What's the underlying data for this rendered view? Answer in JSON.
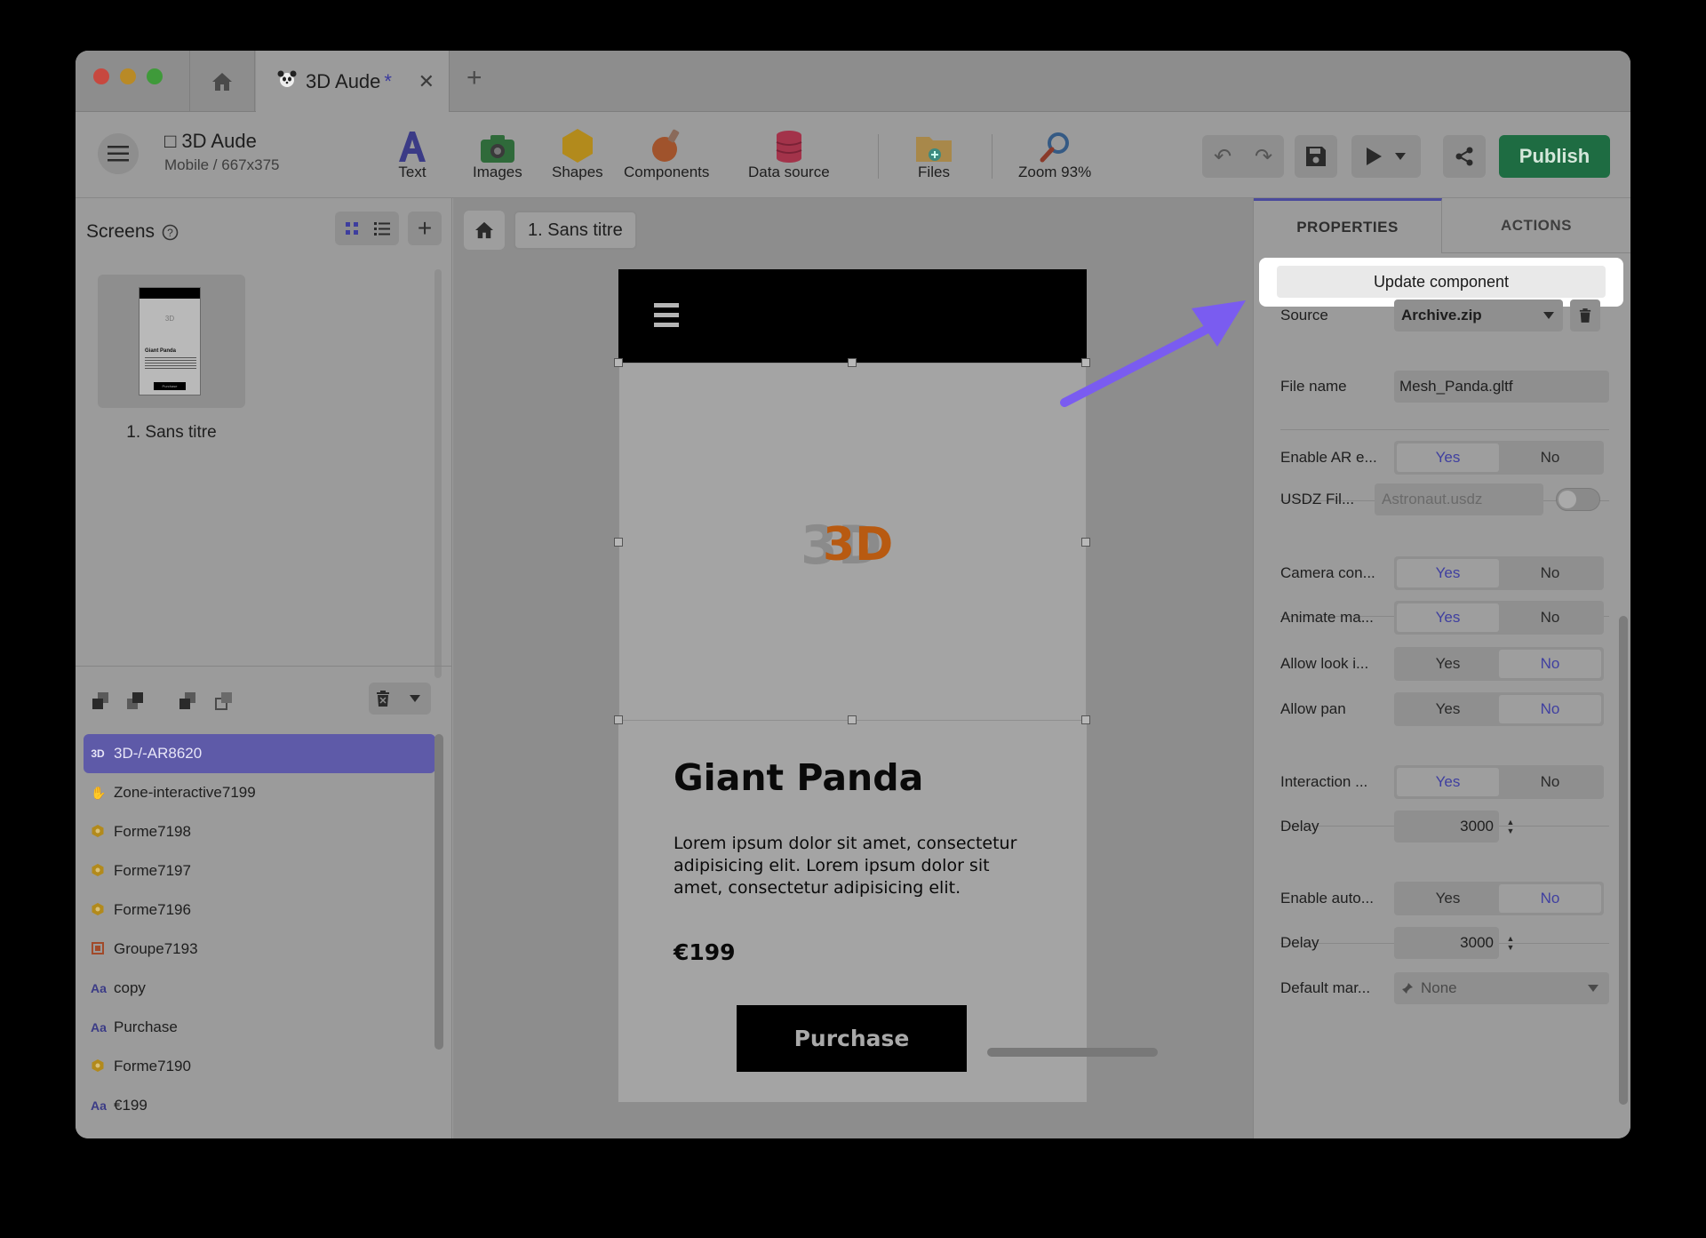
{
  "tab": {
    "title": "3D Aude",
    "modified": "*"
  },
  "project": {
    "title": "□ 3D Aude",
    "subtitle": "Mobile / 667x375"
  },
  "toolbar": {
    "text": "Text",
    "images": "Images",
    "shapes": "Shapes",
    "components": "Components",
    "data_source": "Data source",
    "files": "Files",
    "zoom": "Zoom 93%",
    "publish": "Publish"
  },
  "screens": {
    "title": "Screens",
    "items": [
      {
        "label": "1. Sans titre"
      }
    ]
  },
  "thumb": {
    "title": "Giant Panda",
    "button": "Purchase",
    "logo": "3D"
  },
  "layers": [
    {
      "icon": "3D",
      "label": "3D-/-AR8620"
    },
    {
      "icon": "hand",
      "label": "Zone-interactive7199"
    },
    {
      "icon": "hex",
      "label": "Forme7198"
    },
    {
      "icon": "hex",
      "label": "Forme7197"
    },
    {
      "icon": "hex",
      "label": "Forme7196"
    },
    {
      "icon": "group",
      "label": "Groupe7193"
    },
    {
      "icon": "Aa",
      "label": "copy"
    },
    {
      "icon": "Aa",
      "label": "Purchase"
    },
    {
      "icon": "hex",
      "label": "Forme7190"
    },
    {
      "icon": "Aa",
      "label": "€199"
    }
  ],
  "canvas": {
    "breadcrumb": "1. Sans titre",
    "logo": "3D",
    "product_title": "Giant Panda",
    "description": "Lorem ipsum dolor sit amet, consectetur adipisicing elit. Lorem ipsum dolor sit amet, consectetur adipisicing elit.",
    "price": "€199",
    "button": "Purchase"
  },
  "panel": {
    "tab_properties": "PROPERTIES",
    "tab_actions": "ACTIONS",
    "update_button": "Update component",
    "source_label": "Source",
    "source_value": "Archive.zip",
    "filename_label": "File name",
    "filename_value": "Mesh_Panda.gltf",
    "ar_label": "Enable AR e...",
    "usdz_label": "USDZ Fil...",
    "usdz_placeholder": "Astronaut.usdz",
    "camera_label": "Camera con...",
    "animate_label": "Animate ma...",
    "lookin_label": "Allow look i...",
    "pan_label": "Allow pan",
    "interaction_label": "Interaction ...",
    "delay_label": "Delay",
    "delay_value": "3000",
    "autorotate_label": "Enable auto...",
    "delay2_label": "Delay",
    "delay2_value": "3000",
    "default_label": "Default mar...",
    "default_value": "None",
    "yes": "Yes",
    "no": "No"
  },
  "colors": {
    "accent": "#5e5aa8",
    "publish": "#1e6c42",
    "callout_arrow": "#7a5cf0"
  }
}
